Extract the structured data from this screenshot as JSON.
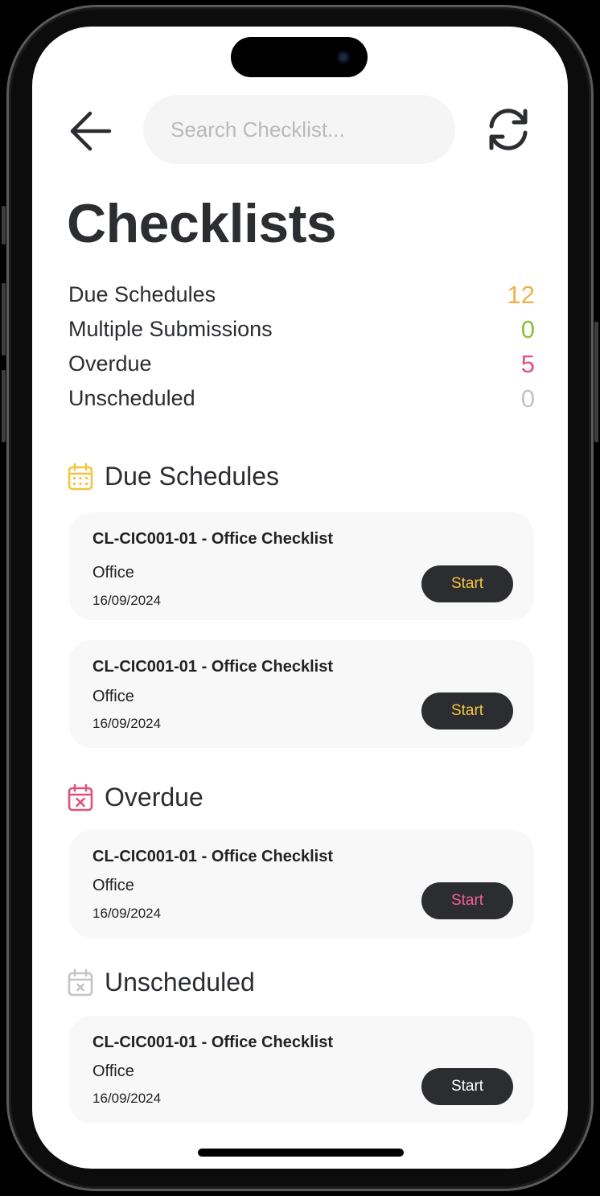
{
  "search": {
    "placeholder": "Search Checklist..."
  },
  "header": {
    "title": "Checklists",
    "back_icon": "arrow-left-icon",
    "refresh_icon": "refresh-icon"
  },
  "colors": {
    "due": "#f0b04a",
    "multiple": "#8cbf3f",
    "overdue": "#e0527a",
    "unscheduled": "#c4c4c4",
    "dark": "#2b2d31",
    "start_due": "#f4c542",
    "start_overdue": "#f0609a",
    "start_unscheduled": "#ffffff"
  },
  "summary": [
    {
      "label": "Due Schedules",
      "count": "12"
    },
    {
      "label": "Multiple Submissions",
      "count": "0"
    },
    {
      "label": "Overdue",
      "count": "5"
    },
    {
      "label": "Unscheduled",
      "count": "0"
    }
  ],
  "sections": {
    "due": {
      "title": "Due Schedules",
      "icon": "calendar-icon",
      "cards": [
        {
          "title": "CL-CIC001-01 - Office Checklist",
          "location": "Office",
          "date": "16/09/2024",
          "action": "Start"
        },
        {
          "title": "CL-CIC001-01 - Office Checklist",
          "location": "Office",
          "date": "16/09/2024",
          "action": "Start"
        }
      ]
    },
    "overdue": {
      "title": "Overdue",
      "icon": "calendar-x-icon",
      "cards": [
        {
          "title": "CL-CIC001-01 - Office Checklist",
          "location": "Office",
          "date": "16/09/2024",
          "action": "Start"
        }
      ]
    },
    "unscheduled": {
      "title": "Unscheduled",
      "icon": "calendar-x-icon",
      "cards": [
        {
          "title": "CL-CIC001-01 - Office Checklist",
          "location": "Office",
          "date": "16/09/2024",
          "action": "Start"
        }
      ]
    }
  }
}
